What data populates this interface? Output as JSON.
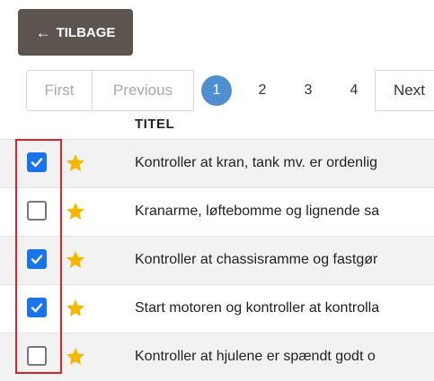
{
  "back_button": {
    "label": "TILBAGE",
    "icon": "arrow-left-icon"
  },
  "pagination": {
    "first": "First",
    "previous": "Previous",
    "pages": [
      "1",
      "2",
      "3",
      "4"
    ],
    "current_page": "1",
    "next": "Next"
  },
  "table": {
    "column_title": "TITEL",
    "rows": [
      {
        "checked": true,
        "text": "Kontroller at kran, tank mv. er ordenlig"
      },
      {
        "checked": false,
        "text": "Kranarme, løftebomme og lignende sa"
      },
      {
        "checked": true,
        "text": "Kontroller at chassisramme og fastgør"
      },
      {
        "checked": true,
        "text": "Start motoren og kontroller at kontrolla"
      },
      {
        "checked": false,
        "text": "Kontroller at hjulene er spændt godt o"
      }
    ]
  },
  "colors": {
    "back_button_bg": "#5c554f",
    "checkbox_checked": "#1a73e8",
    "star": "#f5b700",
    "active_page": "#4f8fcf",
    "highlight_border": "#d9232d"
  }
}
